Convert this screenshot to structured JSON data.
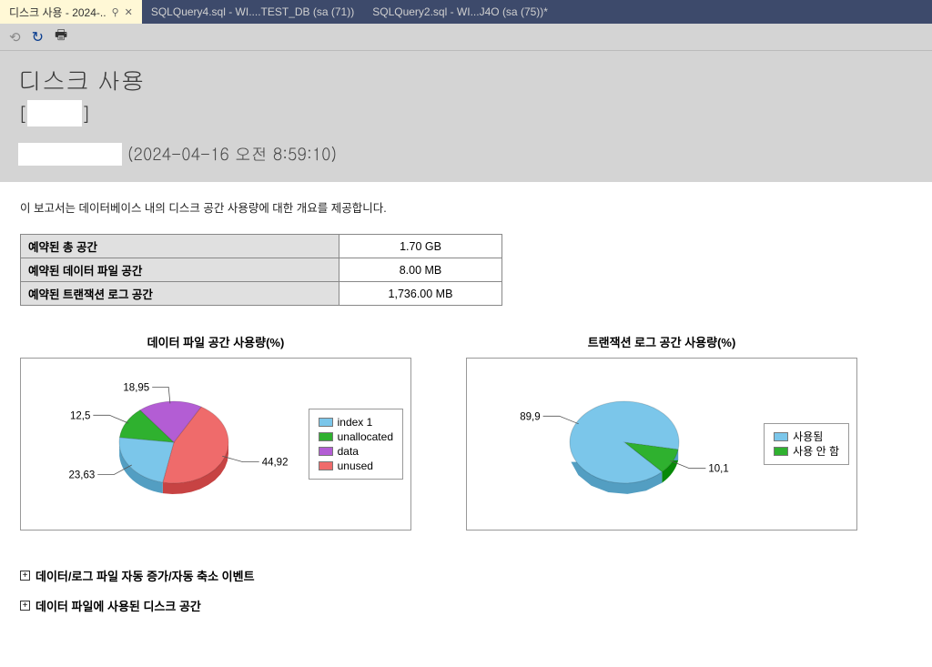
{
  "tabs": [
    {
      "label": "디스크 사용 - 2024-..",
      "active": true
    },
    {
      "label": "SQLQuery4.sql - WI....TEST_DB (sa (71))",
      "active": false
    },
    {
      "label": "SQLQuery2.sql - WI...J4O        (sa (75))*",
      "active": false
    }
  ],
  "report": {
    "title": "디스크 사용",
    "sub_open": "[",
    "sub_masked": "         ",
    "sub_close": "]",
    "server_prefix_masked": "                   ",
    "timestamp": "(2024-04-16 오전 8:59:10)",
    "description": "이 보고서는 데이터베이스 내의 디스크 공간 사용량에 대한 개요를 제공합니다."
  },
  "summary": [
    {
      "label": "예약된 총 공간",
      "value": "1.70 GB"
    },
    {
      "label": "예약된 데이터 파일 공간",
      "value": "8.00 MB"
    },
    {
      "label": "예약된 트랜잭션 로그 공간",
      "value": "1,736.00 MB"
    }
  ],
  "charts": {
    "data_file": {
      "title": "데이터 파일 공간 사용량(%)",
      "legend": [
        {
          "name": "index 1",
          "color": "#7bc6ea"
        },
        {
          "name": "unallocated",
          "color": "#2fb12f"
        },
        {
          "name": "data",
          "color": "#b35dd4"
        },
        {
          "name": "unused",
          "color": "#ef6b6b"
        }
      ]
    },
    "tlog": {
      "title": "트랜잭션 로그 공간 사용량(%)",
      "legend": [
        {
          "name": "사용됨",
          "color": "#7bc6ea"
        },
        {
          "name": "사용 안 함",
          "color": "#2fb12f"
        }
      ]
    }
  },
  "expanders": [
    "데이터/로그 파일 자동 증가/자동 축소 이벤트",
    "데이터 파일에 사용된 디스크 공간"
  ],
  "chart_data": [
    {
      "type": "pie",
      "title": "데이터 파일 공간 사용량(%)",
      "series": [
        {
          "name": "index 1",
          "value": 23.63,
          "color": "#7bc6ea"
        },
        {
          "name": "unallocated",
          "value": 12.5,
          "color": "#2fb12f"
        },
        {
          "name": "data",
          "value": 18.95,
          "color": "#b35dd4"
        },
        {
          "name": "unused",
          "value": 44.92,
          "color": "#ef6b6b"
        }
      ],
      "unit": "%"
    },
    {
      "type": "pie",
      "title": "트랜잭션 로그 공간 사용량(%)",
      "series": [
        {
          "name": "사용됨",
          "value": 89.9,
          "color": "#7bc6ea"
        },
        {
          "name": "사용 안 함",
          "value": 10.1,
          "color": "#2fb12f"
        }
      ],
      "unit": "%"
    }
  ]
}
